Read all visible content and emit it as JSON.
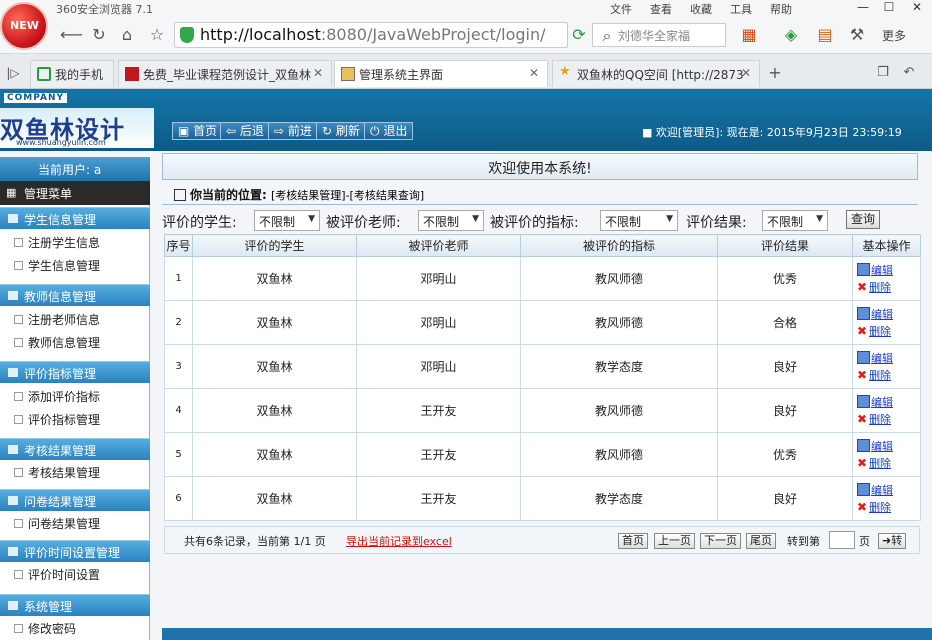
{
  "browser": {
    "app_title": "360安全浏览器 7.1",
    "window_menu": [
      "文件",
      "查看",
      "收藏",
      "工具",
      "帮助"
    ],
    "logo_text": "NEW",
    "url_host": "http://localhost",
    "url_rest": ":8080/JavaWebProject/login/",
    "search_placeholder": "刘德华全家福",
    "more_label": "更多",
    "tabs": [
      {
        "label": "我的手机"
      },
      {
        "label": "免费_毕业课程范例设计_双鱼林"
      },
      {
        "label": "管理系统主界面"
      },
      {
        "label": "双鱼林的QQ空间 [http://2873"
      }
    ]
  },
  "header": {
    "company": "COMPANY",
    "brand": "双鱼林设计",
    "brand_url": "www.shuangyulin.com",
    "toolbar": [
      "首页",
      "后退",
      "前进",
      "刷新",
      "退出"
    ],
    "welcome": "欢迎[管理员]:    现在是: 2015年9月23日 23:59:19"
  },
  "sidebar": {
    "current_user": "当前用户: a",
    "menu_title": "管理菜单",
    "groups": [
      {
        "title": "学生信息管理",
        "items": [
          "注册学生信息",
          "学生信息管理"
        ]
      },
      {
        "title": "教师信息管理",
        "items": [
          "注册老师信息",
          "教师信息管理"
        ]
      },
      {
        "title": "评价指标管理",
        "items": [
          "添加评价指标",
          "评价指标管理"
        ]
      },
      {
        "title": "考核结果管理",
        "items": [
          "考核结果管理"
        ]
      },
      {
        "title": "问卷结果管理",
        "items": [
          "问卷结果管理"
        ]
      },
      {
        "title": "评价时间设置管理",
        "items": [
          "评价时间设置"
        ]
      },
      {
        "title": "系统管理",
        "items": [
          "修改密码"
        ]
      }
    ]
  },
  "main": {
    "welcome_banner": "欢迎使用本系统!",
    "location_label": "你当前的位置:",
    "location_trail": "[考核结果管理]-[考核结果查询]",
    "filters": {
      "student_label": "评价的学生:",
      "teacher_label": "被评价老师:",
      "indicator_label": "被评价的指标:",
      "result_label": "评价结果:",
      "student_value": "不限制",
      "teacher_value": "不限制",
      "indicator_value": "不限制",
      "result_value": "不限制",
      "query_button": "查询"
    },
    "columns": [
      "序号",
      "评价的学生",
      "被评价老师",
      "被评价的指标",
      "评价结果",
      "基本操作"
    ],
    "rows": [
      {
        "seq": "1",
        "student": "双鱼林",
        "teacher": "邓明山",
        "indicator": "教风师德",
        "result": "优秀"
      },
      {
        "seq": "2",
        "student": "双鱼林",
        "teacher": "邓明山",
        "indicator": "教风师德",
        "result": "合格"
      },
      {
        "seq": "3",
        "student": "双鱼林",
        "teacher": "邓明山",
        "indicator": "教学态度",
        "result": "良好"
      },
      {
        "seq": "4",
        "student": "双鱼林",
        "teacher": "王开友",
        "indicator": "教风师德",
        "result": "良好"
      },
      {
        "seq": "5",
        "student": "双鱼林",
        "teacher": "王开友",
        "indicator": "教风师德",
        "result": "优秀"
      },
      {
        "seq": "6",
        "student": "双鱼林",
        "teacher": "王开友",
        "indicator": "教学态度",
        "result": "良好"
      }
    ],
    "op_edit": "编辑",
    "op_delete": "删除",
    "record_info": "共有6条记录，当前第 1/1 页",
    "export_link": "导出当前记录到excel",
    "pager": {
      "first": "首页",
      "prev": "上一页",
      "next": "下一页",
      "last": "尾页",
      "goto_label": "转到第",
      "page_suffix": "页",
      "go": "转"
    }
  }
}
